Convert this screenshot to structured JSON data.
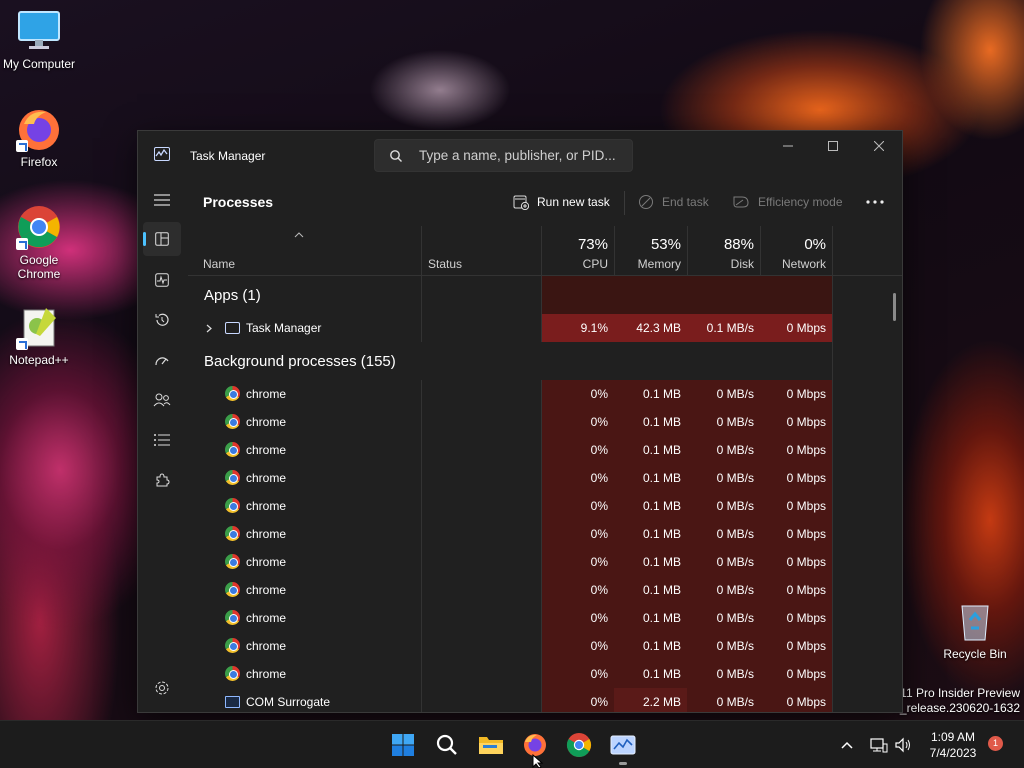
{
  "desktop": {
    "icons": [
      {
        "label": "My Computer",
        "icon": "monitor-icon"
      },
      {
        "label": "Firefox",
        "icon": "firefox-icon"
      },
      {
        "label": "Google Chrome",
        "icon": "chrome-icon"
      },
      {
        "label": "Notepad++",
        "icon": "notepadpp-icon"
      },
      {
        "label": "Recycle Bin",
        "icon": "recycle-bin-icon"
      }
    ],
    "watermark_line1": "11 Pro Insider Preview",
    "watermark_line2": "n_release.230620-1632"
  },
  "window": {
    "title": "Task Manager",
    "search_placeholder": "Type a name, publisher, or PID..."
  },
  "toolbar": {
    "page_title": "Processes",
    "run_new_task": "Run new task",
    "end_task": "End task",
    "efficiency_mode": "Efficiency mode"
  },
  "columns": {
    "name": "Name",
    "status": "Status",
    "cpu": {
      "label": "CPU",
      "pct": "73%"
    },
    "memory": {
      "label": "Memory",
      "pct": "53%"
    },
    "disk": {
      "label": "Disk",
      "pct": "88%"
    },
    "network": {
      "label": "Network",
      "pct": "0%"
    }
  },
  "groups": {
    "apps": "Apps (1)",
    "background": "Background processes (155)"
  },
  "rows": [
    {
      "name": "Task Manager",
      "cpu": "9.1%",
      "mem": "42.3 MB",
      "disk": "0.1 MB/s",
      "net": "0 Mbps"
    },
    {
      "name": "chrome",
      "cpu": "0%",
      "mem": "0.1 MB",
      "disk": "0 MB/s",
      "net": "0 Mbps"
    },
    {
      "name": "chrome",
      "cpu": "0%",
      "mem": "0.1 MB",
      "disk": "0 MB/s",
      "net": "0 Mbps"
    },
    {
      "name": "chrome",
      "cpu": "0%",
      "mem": "0.1 MB",
      "disk": "0 MB/s",
      "net": "0 Mbps"
    },
    {
      "name": "chrome",
      "cpu": "0%",
      "mem": "0.1 MB",
      "disk": "0 MB/s",
      "net": "0 Mbps"
    },
    {
      "name": "chrome",
      "cpu": "0%",
      "mem": "0.1 MB",
      "disk": "0 MB/s",
      "net": "0 Mbps"
    },
    {
      "name": "chrome",
      "cpu": "0%",
      "mem": "0.1 MB",
      "disk": "0 MB/s",
      "net": "0 Mbps"
    },
    {
      "name": "chrome",
      "cpu": "0%",
      "mem": "0.1 MB",
      "disk": "0 MB/s",
      "net": "0 Mbps"
    },
    {
      "name": "chrome",
      "cpu": "0%",
      "mem": "0.1 MB",
      "disk": "0 MB/s",
      "net": "0 Mbps"
    },
    {
      "name": "chrome",
      "cpu": "0%",
      "mem": "0.1 MB",
      "disk": "0 MB/s",
      "net": "0 Mbps"
    },
    {
      "name": "chrome",
      "cpu": "0%",
      "mem": "0.1 MB",
      "disk": "0 MB/s",
      "net": "0 Mbps"
    },
    {
      "name": "chrome",
      "cpu": "0%",
      "mem": "0.1 MB",
      "disk": "0 MB/s",
      "net": "0 Mbps"
    },
    {
      "name": "COM Surrogate",
      "cpu": "0%",
      "mem": "2.2 MB",
      "disk": "0 MB/s",
      "net": "0 Mbps"
    }
  ],
  "taskbar": {
    "time": "1:09 AM",
    "date": "7/4/2023",
    "notifications": "1"
  },
  "colors": {
    "accent": "#4cc2ff",
    "heat_high": "#7a1d1d",
    "heat_low": "#4a1614"
  }
}
